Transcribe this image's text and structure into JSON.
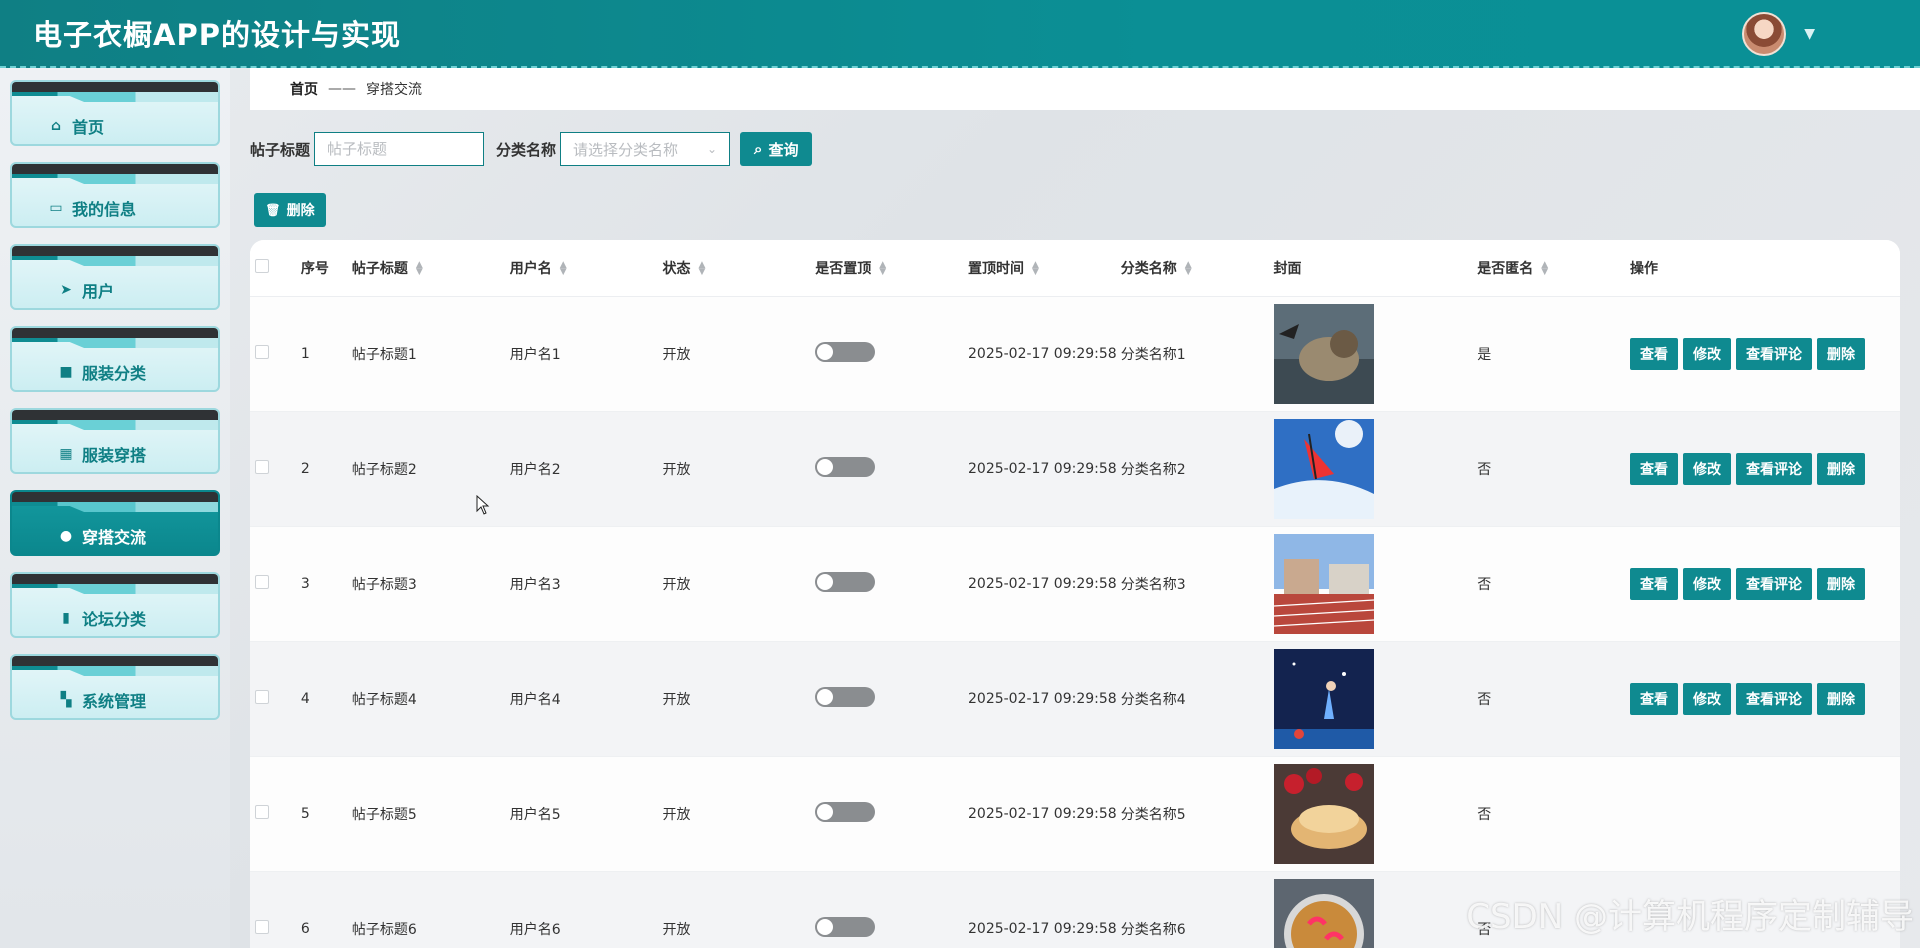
{
  "app": {
    "title": "电子衣橱APP的设计与实现"
  },
  "user": {
    "avatar_icon": "user-avatar",
    "caret_icon": "chevron-down-icon"
  },
  "sidebar": {
    "items": [
      {
        "label": "首页",
        "icon": "home-icon",
        "active": false
      },
      {
        "label": "我的信息",
        "icon": "id-card-icon",
        "active": false
      },
      {
        "label": "用户",
        "icon": "paper-plane-icon",
        "active": false
      },
      {
        "label": "服装分类",
        "icon": "briefcase-icon",
        "active": false
      },
      {
        "label": "服装穿搭",
        "icon": "chart-icon",
        "active": false
      },
      {
        "label": "穿搭交流",
        "icon": "user-icon",
        "active": true
      },
      {
        "label": "论坛分类",
        "icon": "book-icon",
        "active": false
      },
      {
        "label": "系统管理",
        "icon": "grid-icon",
        "active": false
      }
    ]
  },
  "breadcrumb": {
    "home": "首页",
    "separator": "——",
    "current": "穿搭交流"
  },
  "search": {
    "title_label": "帖子标题",
    "title_placeholder": "帖子标题",
    "category_label": "分类名称",
    "category_placeholder": "请选择分类名称",
    "query_button": "查询"
  },
  "toolbar": {
    "delete_button": "删除"
  },
  "table": {
    "headers": {
      "index": "序号",
      "title": "帖子标题",
      "username": "用户名",
      "status": "状态",
      "pinned": "是否置顶",
      "pin_time": "置顶时间",
      "category": "分类名称",
      "cover": "封面",
      "anonymous": "是否匿名",
      "actions": "操作"
    },
    "action_labels": {
      "view": "查看",
      "edit": "修改",
      "view_comments": "查看评论",
      "delete": "删除"
    },
    "rows": [
      {
        "index": "1",
        "title": "帖子标题1",
        "username": "用户名1",
        "status": "开放",
        "pin_time": "2025-02-17 09:29:58",
        "category": "分类名称1",
        "cover": "fantasy-lion",
        "anonymous": "是"
      },
      {
        "index": "2",
        "title": "帖子标题2",
        "username": "用户名2",
        "status": "开放",
        "pin_time": "2025-02-17 09:29:58",
        "category": "分类名称2",
        "cover": "windsurfer",
        "anonymous": "否"
      },
      {
        "index": "3",
        "title": "帖子标题3",
        "username": "用户名3",
        "status": "开放",
        "pin_time": "2025-02-17 09:29:58",
        "category": "分类名称3",
        "cover": "running-track",
        "anonymous": "否"
      },
      {
        "index": "4",
        "title": "帖子标题4",
        "username": "用户名4",
        "status": "开放",
        "pin_time": "2025-02-17 09:29:58",
        "category": "分类名称4",
        "cover": "night-girl",
        "anonymous": "否"
      },
      {
        "index": "5",
        "title": "帖子标题5",
        "username": "用户名5",
        "status": "开放",
        "pin_time": "2025-02-17 09:29:58",
        "category": "分类名称5",
        "cover": "pancake-berries",
        "anonymous": "否"
      },
      {
        "index": "6",
        "title": "帖子标题6",
        "username": "用户名6",
        "status": "开放",
        "pin_time": "2025-02-17 09:29:58",
        "category": "分类名称6",
        "cover": "shrimp-dish",
        "anonymous": "否"
      }
    ]
  },
  "watermark": "CSDN @计算机程序定制辅导",
  "colors": {
    "primary": "#0f8a90",
    "header": "#0b8f95",
    "sidebar_active": "#0f878d"
  }
}
